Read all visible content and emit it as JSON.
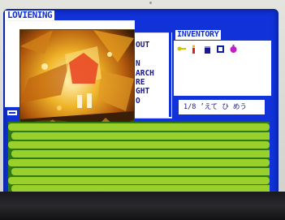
{
  "window": {
    "title": "LOVIENING"
  },
  "commands": {
    "items": [
      "OUT",
      "N",
      "ARCH",
      "RE",
      "GHT",
      "O"
    ]
  },
  "inventory": {
    "title": "INVENTORY",
    "status": "1/8 ’えて ひ めう"
  },
  "icons": {
    "inventory": [
      "key-icon",
      "candle-icon",
      "jar-icon",
      "crate-icon",
      "potion-icon"
    ],
    "small": "scroll-icon"
  },
  "colors": {
    "screen": "#1032d8",
    "accent_text": "#0f2fd0",
    "field_dark": "#2e7a18",
    "field_light": "#9ad02c"
  }
}
